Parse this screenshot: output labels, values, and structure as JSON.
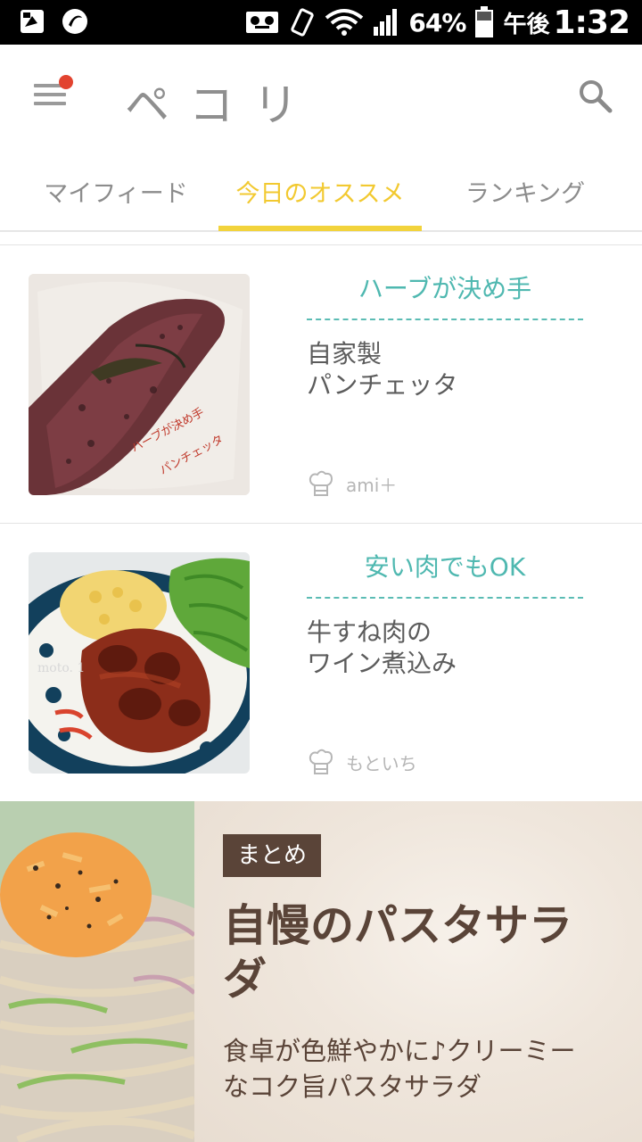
{
  "status_bar": {
    "battery_percent": "64%",
    "ampm": "午後",
    "time": "1:32"
  },
  "app_bar": {
    "logo": "ペコリ",
    "icons": [
      "menu-icon",
      "notification-dot",
      "search-icon"
    ],
    "notification_color": "#e2432f"
  },
  "tabs": [
    {
      "label": "マイフィード",
      "active": false
    },
    {
      "label": "今日のオススメ",
      "active": true
    },
    {
      "label": "ランキング",
      "active": false
    }
  ],
  "colors": {
    "accent": "#f2d33c",
    "teal": "#4fb8b0",
    "summary_brown": "#5a4438"
  },
  "recipes": [
    {
      "catchphrase": "ハーブが決め手",
      "title_line1": "自家製",
      "title_line2": "パンチェッタ",
      "author": "ami＋",
      "photo_text_line1": "ハーブが決め手",
      "photo_text_line2": "パンチェッタ"
    },
    {
      "catchphrase": "安い肉でもOK",
      "title_line1": "牛すね肉の",
      "title_line2": "ワイン煮込み",
      "author": "もといち",
      "photo_text_line1": "moto. 1"
    }
  ],
  "summary": {
    "tag": "まとめ",
    "title": "自慢のパスタサラダ",
    "description": "食卓が色鮮やかに♪クリーミーなコク旨パスタサラダ"
  }
}
